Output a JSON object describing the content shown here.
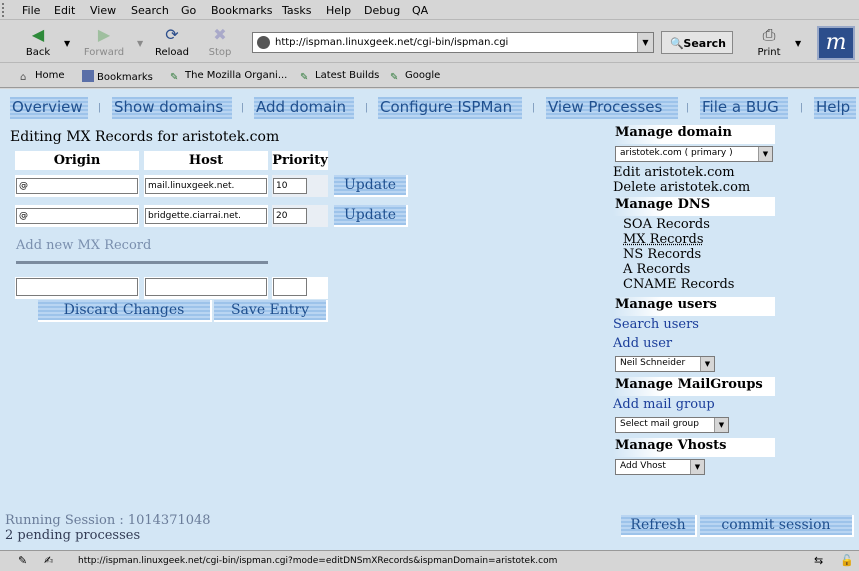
{
  "menu": [
    "File",
    "Edit",
    "View",
    "Search",
    "Go",
    "Bookmarks",
    "Tasks",
    "Help",
    "Debug",
    "QA"
  ],
  "toolbar": {
    "back": "Back",
    "forward": "Forward",
    "reload": "Reload",
    "stop": "Stop",
    "url": "http://ispman.linuxgeek.net/cgi-bin/ispman.cgi",
    "search": "Search",
    "print": "Print"
  },
  "bookmarks_bar": [
    "Home",
    "Bookmarks",
    "The Mozilla Organi...",
    "Latest Builds",
    "Google"
  ],
  "topnav": [
    "Overview",
    "Show domains",
    "Add domain",
    "Configure ISPMan",
    "View Processes",
    "File a BUG",
    "Help"
  ],
  "page": {
    "title": "Editing MX Records for aristotek.com",
    "columns": [
      "Origin",
      "Host",
      "Priority"
    ],
    "records": [
      {
        "origin": "@",
        "host": "mail.linuxgeek.net.",
        "priority": "10",
        "button": "Update"
      },
      {
        "origin": "@",
        "host": "bridgette.ciarrai.net.",
        "priority": "20",
        "button": "Update"
      }
    ],
    "add_new_label": "Add new MX Record",
    "discard_label": "Discard Changes",
    "save_label": "Save Entry"
  },
  "sidebar": {
    "manage_domain": "Manage domain",
    "domain_select": "aristotek.com ( primary )",
    "edit_domain": "Edit aristotek.com",
    "delete_domain": "Delete aristotek.com",
    "manage_dns": "Manage DNS",
    "dns_items": [
      "SOA Records",
      "MX Records",
      "NS Records",
      "A Records",
      "CNAME Records"
    ],
    "manage_users": "Manage users",
    "search_users": "Search users",
    "add_user": "Add user",
    "user_select": "Neil Schneider",
    "manage_mailgroups": "Manage MailGroups",
    "add_mailgroup": "Add mail group",
    "mailgroup_select": "Select mail group",
    "manage_vhosts": "Manage Vhosts",
    "vhost_select": "Add Vhost"
  },
  "footer": {
    "session": "Running Session : 1014371048",
    "pending": "2 pending processes",
    "refresh": "Refresh",
    "commit": "commit session"
  },
  "status": "http://ispman.linuxgeek.net/cgi-bin/ispman.cgi?mode=editDNSmXRecords&ispmanDomain=aristotek.com"
}
